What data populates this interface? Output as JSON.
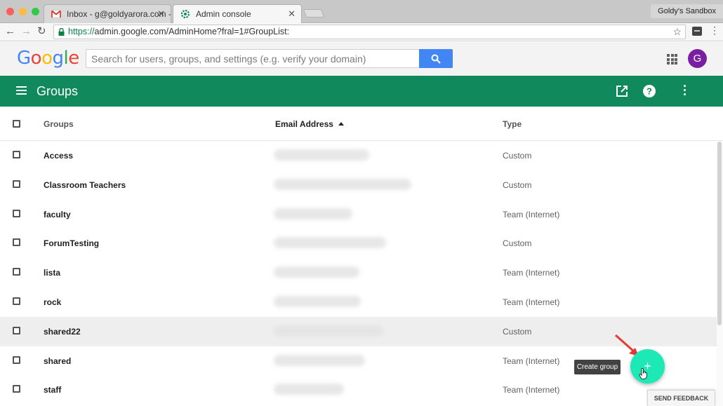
{
  "browser": {
    "tabs": [
      {
        "title": "Inbox - g@goldyarora.com - G",
        "icon": "gmail-icon"
      },
      {
        "title": "Admin console",
        "icon": "admin-icon"
      }
    ],
    "profile_name": "Goldy's Sandbox",
    "url_scheme": "https://",
    "url_rest": "admin.google.com/AdminHome?fral=1#GroupList:"
  },
  "header": {
    "logo": "Google",
    "search_placeholder": "Search for users, groups, and settings (e.g. verify your domain)",
    "avatar_letter": "G"
  },
  "appbar": {
    "title": "Groups"
  },
  "table": {
    "columns": {
      "groups": "Groups",
      "email": "Email Address",
      "type": "Type"
    },
    "rows": [
      {
        "name": "Access",
        "type": "Custom",
        "selected": false
      },
      {
        "name": "Classroom Teachers",
        "type": "Custom",
        "selected": false
      },
      {
        "name": "faculty",
        "type": "Team (Internet)",
        "selected": false
      },
      {
        "name": "ForumTesting",
        "type": "Custom",
        "selected": false
      },
      {
        "name": "lista",
        "type": "Team (Internet)",
        "selected": false
      },
      {
        "name": "rock",
        "type": "Team (Internet)",
        "selected": false
      },
      {
        "name": "shared22",
        "type": "Custom",
        "selected": true
      },
      {
        "name": "shared",
        "type": "Team (Internet)",
        "selected": false
      },
      {
        "name": "staff",
        "type": "Team (Internet)",
        "selected": false
      }
    ]
  },
  "fab": {
    "tooltip": "Create group",
    "symbol": "+"
  },
  "feedback_label": "SEND FEEDBACK",
  "colors": {
    "appbar": "#108a5d",
    "fab": "#1de9b6",
    "search_button": "#4285f4",
    "avatar": "#7b1fa2"
  }
}
